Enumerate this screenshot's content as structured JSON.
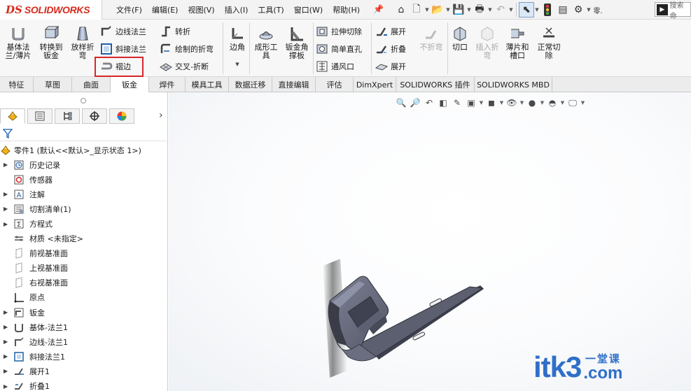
{
  "app": {
    "logo_mark": "DS",
    "logo_text": "SOLIDWORKS"
  },
  "menu": {
    "items": [
      "文件(F)",
      "编辑(E)",
      "视图(V)",
      "插入(I)",
      "工具(T)",
      "窗口(W)",
      "帮助(H)"
    ]
  },
  "search": {
    "placeholder": "搜索命"
  },
  "ribbon": {
    "base_flange": "基体法兰/薄片",
    "convert_to_sheet": "转换到钣金",
    "lofted_bend": "放样折弯",
    "edge_flange": "边线法兰",
    "miter_flange": "斜接法兰",
    "hem": "褶边",
    "jog": "转折",
    "sketched_bend": "绘制的折弯",
    "cross_break": "交叉-折断",
    "corners": "边角",
    "forming_tool": "成形工具",
    "gusset": "钣金角撑板",
    "extruded_cut": "拉伸切除",
    "simple_hole": "简单直孔",
    "vent": "通风口",
    "unfold": "展开",
    "fold": "折叠",
    "flatten": "展开",
    "no_bends": "不折弯",
    "rip": "切口",
    "insert_bends": "插入折弯",
    "tab_and_slot": "薄片和槽口",
    "normal_cut": "正常切除"
  },
  "tabs": [
    "特征",
    "草图",
    "曲面",
    "钣金",
    "焊件",
    "模具工具",
    "数据迁移",
    "直接编辑",
    "评估",
    "DimXpert",
    "SOLIDWORKS 插件",
    "SOLIDWORKS MBD"
  ],
  "active_tab": "钣金",
  "tree": {
    "root": "零件1 (默认<<默认>_显示状态 1>)",
    "items": [
      {
        "label": "历史记录",
        "expandable": true,
        "icon": "history-icon"
      },
      {
        "label": "传感器",
        "expandable": false,
        "icon": "sensor-icon"
      },
      {
        "label": "注解",
        "expandable": true,
        "icon": "annotation-icon"
      },
      {
        "label": "切割清单(1)",
        "expandable": true,
        "icon": "cut-list-icon"
      },
      {
        "label": "方程式",
        "expandable": true,
        "icon": "equation-icon"
      },
      {
        "label": "材质 <未指定>",
        "expandable": false,
        "icon": "material-icon"
      },
      {
        "label": "前视基准面",
        "expandable": false,
        "icon": "plane-icon"
      },
      {
        "label": "上视基准面",
        "expandable": false,
        "icon": "plane-icon"
      },
      {
        "label": "右视基准面",
        "expandable": false,
        "icon": "plane-icon"
      },
      {
        "label": "原点",
        "expandable": false,
        "icon": "origin-icon"
      },
      {
        "label": "钣金",
        "expandable": true,
        "icon": "sheet-metal-icon"
      },
      {
        "label": "基体-法兰1",
        "expandable": true,
        "icon": "base-flange-icon"
      },
      {
        "label": "边线-法兰1",
        "expandable": true,
        "icon": "edge-flange-icon"
      },
      {
        "label": "斜接法兰1",
        "expandable": true,
        "icon": "miter-flange-icon"
      },
      {
        "label": "展开1",
        "expandable": true,
        "icon": "unfold-icon"
      },
      {
        "label": "折叠1",
        "expandable": true,
        "icon": "fold-icon"
      }
    ]
  },
  "watermark": {
    "brand": "itk3",
    "tagline": "一堂课",
    "domain": ".com"
  },
  "colors": {
    "accent_red": "#d6262a",
    "watermark_blue": "#2f6fc9",
    "part_gray": "#5c5f6f"
  }
}
